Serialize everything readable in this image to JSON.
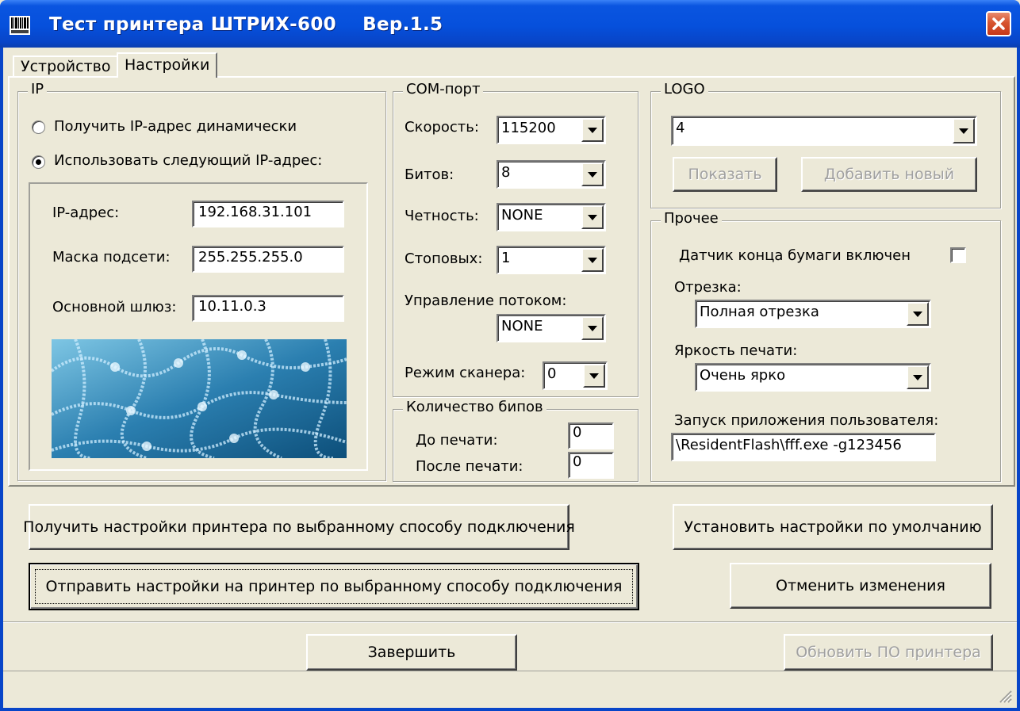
{
  "window": {
    "title": "Тест принтера ШТРИХ-600    Вер.1.5",
    "title_icon": "barcode-icon",
    "close_icon": "close-icon"
  },
  "tabs": [
    {
      "label": "Устройство",
      "active": false
    },
    {
      "label": "Настройки",
      "active": true
    }
  ],
  "ip_group": {
    "title": "IP",
    "radio_dynamic": {
      "label": "Получить IP-адрес динамически",
      "checked": false
    },
    "radio_static": {
      "label": "Использовать следующий IP-адрес:",
      "checked": true
    },
    "ip_label": "IP-адрес:",
    "ip_value": "192.168.31.101",
    "mask_label": "Маска подсети:",
    "mask_value": "255.255.255.0",
    "gateway_label": "Основной шлюз:",
    "gateway_value": "10.11.0.3"
  },
  "com_group": {
    "title": "COM-порт",
    "speed_label": "Скорость:",
    "speed_value": "115200",
    "bits_label": "Битов:",
    "bits_value": "8",
    "parity_label": "Четность:",
    "parity_value": "NONE",
    "stop_label": "Стоповых:",
    "stop_value": "1",
    "flow_label": "Управление потоком:",
    "flow_value": "NONE",
    "scanner_label": "Режим сканера:",
    "scanner_value": "0"
  },
  "beeps_group": {
    "title": "Количество бипов",
    "before_label": "До печати:",
    "before_value": "0",
    "after_label": "После печати:",
    "after_value": "0"
  },
  "logo_group": {
    "title": "LOGO",
    "logo_value": "4",
    "show_button": "Показать",
    "add_button": "Добавить новый"
  },
  "other_group": {
    "title": "Прочее",
    "paper_sensor_label": "Датчик конца бумаги включен",
    "paper_sensor_checked": false,
    "cut_label": "Отрезка:",
    "cut_value": "Полная отрезка",
    "brightness_label": "Яркость печати:",
    "brightness_value": "Очень ярко",
    "app_label": "Запуск приложения пользователя:",
    "app_value": "\\ResidentFlash\\fff.exe -g123456"
  },
  "actions": {
    "get_settings": "Получить настройки принтера по выбранному способу подключения",
    "default_settings": "Установить настройки по умолчанию",
    "send_settings": "Отправить настройки на принтер по выбранному способу подключения",
    "cancel_changes": "Отменить изменения"
  },
  "footer": {
    "finish": "Завершить",
    "update_firmware": "Обновить ПО принтера"
  },
  "colors": {
    "titlebar": "#0650dc",
    "window_bg": "#ece9d8",
    "disabled_text": "#a0a0a0"
  }
}
